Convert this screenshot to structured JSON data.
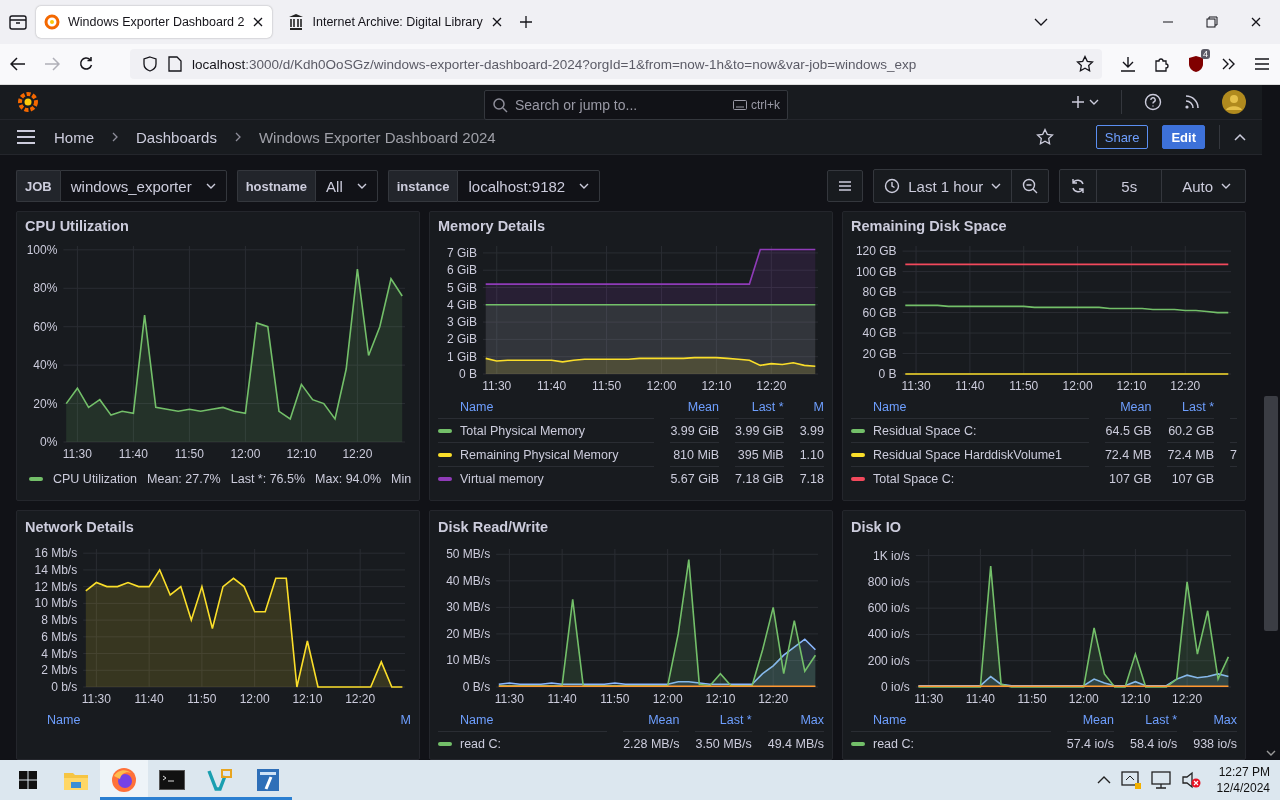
{
  "browser": {
    "tabs": [
      {
        "title": "Windows Exporter Dashboard 2",
        "selected": true
      },
      {
        "title": "Internet Archive: Digital Library",
        "selected": false
      }
    ],
    "url_host": "localhost",
    "url_rest": ":3000/d/Kdh0OoSGz/windows-exporter-dashboard-2024?orgId=1&from=now-1h&to=now&var-job=windows_exp",
    "extension_badge": "4"
  },
  "topbar": {
    "search_placeholder": "Search or jump to...",
    "shortcut": "ctrl+k"
  },
  "breadcrumbs": [
    "Home",
    "Dashboards",
    "Windows Exporter Dashboard 2024"
  ],
  "actions": {
    "share": "Share",
    "edit": "Edit"
  },
  "variables": [
    {
      "label": "JOB",
      "value": "windows_exporter"
    },
    {
      "label": "hostname",
      "value": "All"
    },
    {
      "label": "instance",
      "value": "localhost:9182"
    }
  ],
  "time_range": "Last 1 hour",
  "refresh_interval": "5s",
  "refresh_mode": "Auto",
  "panels": [
    {
      "title": "CPU Utilization",
      "chart_data": {
        "type": "area",
        "grid": true,
        "categories": [
          null,
          "11:30",
          null,
          null,
          null,
          null,
          "11:40",
          null,
          null,
          null,
          null,
          "11:50",
          null,
          null,
          null,
          null,
          "12:00",
          null,
          null,
          null,
          null,
          "12:10",
          null,
          null,
          null,
          null,
          "12:20",
          null,
          null,
          null,
          null
        ],
        "ylim": [
          0,
          102
        ],
        "yticks": [
          {
            "value": 0,
            "label": "0%"
          },
          {
            "value": 20,
            "label": "20%"
          },
          {
            "value": 40,
            "label": "40%"
          },
          {
            "value": 60,
            "label": "60%"
          },
          {
            "value": 80,
            "label": "80%"
          },
          {
            "value": 100,
            "label": "100%"
          }
        ],
        "series": [
          {
            "color": "#73bf69",
            "values": [
              20,
              28,
              18,
              22,
              14,
              16,
              15,
              66,
              18,
              17,
              16,
              17,
              16,
              17,
              18,
              16,
              15,
              62,
              60,
              16,
              12,
              30,
              22,
              20,
              12,
              38,
              90,
              45,
              60,
              85,
              76
            ]
          }
        ]
      },
      "legend": {
        "kind": "inline",
        "items": [
          {
            "name": "CPU Utilization",
            "color": "#73bf69",
            "stats": [
              "Mean: 27.7%",
              "Last *: 76.5%",
              "Max: 94.0%",
              "Min"
            ]
          }
        ]
      }
    },
    {
      "title": "Memory Details",
      "chart_data": {
        "type": "area",
        "grid": true,
        "categories": [
          null,
          "11:30",
          null,
          null,
          null,
          null,
          "11:40",
          null,
          null,
          null,
          null,
          "11:50",
          null,
          null,
          null,
          null,
          "12:00",
          null,
          null,
          null,
          null,
          "12:10",
          null,
          null,
          null,
          null,
          "12:20",
          null,
          null,
          null,
          null
        ],
        "ylim": [
          0,
          7.4
        ],
        "yticks": [
          {
            "value": 0,
            "label": "0 B"
          },
          {
            "value": 1,
            "label": "1 GiB"
          },
          {
            "value": 2,
            "label": "2 GiB"
          },
          {
            "value": 3,
            "label": "3 GiB"
          },
          {
            "value": 4,
            "label": "4 GiB"
          },
          {
            "value": 5,
            "label": "5 GiB"
          },
          {
            "value": 6,
            "label": "6 GiB"
          },
          {
            "value": 7,
            "label": "7 GiB"
          }
        ],
        "series": [
          {
            "color": "#8f3bb8",
            "values": [
              5.2,
              5.2,
              5.2,
              5.2,
              5.2,
              5.2,
              5.2,
              5.2,
              5.2,
              5.2,
              5.2,
              5.2,
              5.2,
              5.2,
              5.2,
              5.2,
              5.2,
              5.2,
              5.2,
              5.2,
              5.2,
              5.2,
              5.2,
              5.2,
              5.2,
              7.2,
              7.2,
              7.2,
              7.2,
              7.2,
              7.2
            ]
          },
          {
            "color": "#73bf69",
            "values": [
              4,
              4,
              4,
              4,
              4,
              4,
              4,
              4,
              4,
              4,
              4,
              4,
              4,
              4,
              4,
              4,
              4,
              4,
              4,
              4,
              4,
              4,
              4,
              4,
              4,
              4,
              4,
              4,
              4,
              4,
              4
            ]
          },
          {
            "color": "#fade2a",
            "values": [
              0.9,
              0.75,
              0.8,
              0.8,
              0.8,
              0.8,
              0.8,
              0.7,
              0.8,
              0.85,
              0.85,
              0.85,
              0.85,
              0.85,
              0.9,
              0.9,
              0.9,
              0.9,
              0.9,
              0.95,
              0.95,
              0.95,
              0.9,
              0.85,
              0.8,
              0.5,
              0.6,
              0.55,
              0.65,
              0.5,
              0.45
            ]
          }
        ]
      },
      "legend": {
        "kind": "table",
        "columns": [
          "Name",
          "Mean",
          "Last *",
          "M"
        ],
        "rows": [
          {
            "name": "Total Physical Memory",
            "color": "#73bf69",
            "values": [
              "3.99 GiB",
              "3.99 GiB",
              "3.99"
            ]
          },
          {
            "name": "Remaining Physical Memory",
            "color": "#fade2a",
            "values": [
              "810 MiB",
              "395 MiB",
              "1.10"
            ]
          },
          {
            "name": "Virtual memory",
            "color": "#8f3bb8",
            "values": [
              "5.67 GiB",
              "7.18 GiB",
              "7.18"
            ]
          }
        ]
      }
    },
    {
      "title": "Remaining Disk Space",
      "chart_data": {
        "type": "line",
        "grid": true,
        "categories": [
          null,
          "11:30",
          null,
          null,
          null,
          null,
          "11:40",
          null,
          null,
          null,
          null,
          "11:50",
          null,
          null,
          null,
          null,
          "12:00",
          null,
          null,
          null,
          null,
          "12:10",
          null,
          null,
          null,
          null,
          "12:20",
          null,
          null,
          null,
          null
        ],
        "ylim": [
          0,
          125
        ],
        "yticks": [
          {
            "value": 0,
            "label": "0 B"
          },
          {
            "value": 20,
            "label": "20 GB"
          },
          {
            "value": 40,
            "label": "40 GB"
          },
          {
            "value": 60,
            "label": "60 GB"
          },
          {
            "value": 80,
            "label": "80 GB"
          },
          {
            "value": 100,
            "label": "100 GB"
          },
          {
            "value": 120,
            "label": "120 GB"
          }
        ],
        "series": [
          {
            "color": "#73bf69",
            "values": [
              67,
              67,
              67,
              67,
              66,
              66,
              66,
              66,
              66,
              66,
              66,
              66,
              65,
              65,
              65,
              65,
              65,
              65,
              65,
              64,
              64,
              64,
              64,
              63,
              63,
              63,
              62,
              62,
              61,
              60,
              60
            ]
          },
          {
            "color": "#fade2a",
            "values": [
              0,
              0,
              0,
              0,
              0,
              0,
              0,
              0,
              0,
              0,
              0,
              0,
              0,
              0,
              0,
              0,
              0,
              0,
              0,
              0,
              0,
              0,
              0,
              0,
              0,
              0,
              0,
              0,
              0,
              0,
              0
            ]
          },
          {
            "color": "#f2495c",
            "values": [
              107,
              107,
              107,
              107,
              107,
              107,
              107,
              107,
              107,
              107,
              107,
              107,
              107,
              107,
              107,
              107,
              107,
              107,
              107,
              107,
              107,
              107,
              107,
              107,
              107,
              107,
              107,
              107,
              107,
              107,
              107
            ]
          }
        ]
      },
      "legend": {
        "kind": "table",
        "columns": [
          "Name",
          "Mean",
          "Last *"
        ],
        "rows": [
          {
            "name": "Residual Space C:",
            "color": "#73bf69",
            "values": [
              "64.5 GB",
              "60.2 GB"
            ]
          },
          {
            "name": "Residual Space HarddiskVolume1",
            "color": "#fade2a",
            "values": [
              "72.4 MB",
              "72.4 MB",
              "7"
            ]
          },
          {
            "name": "Total Space C:",
            "color": "#f2495c",
            "values": [
              "107 GB",
              "107 GB"
            ]
          }
        ]
      }
    },
    {
      "title": "Network Details",
      "chart_data": {
        "type": "area",
        "grid": true,
        "categories": [
          null,
          "11:30",
          null,
          null,
          null,
          null,
          "11:40",
          null,
          null,
          null,
          null,
          "11:50",
          null,
          null,
          null,
          null,
          "12:00",
          null,
          null,
          null,
          null,
          "12:10",
          null,
          null,
          null,
          null,
          "12:20",
          null,
          null,
          null,
          null
        ],
        "ylim": [
          0,
          16.5
        ],
        "yticks": [
          {
            "value": 0,
            "label": "0 b/s"
          },
          {
            "value": 2,
            "label": "2 Mb/s"
          },
          {
            "value": 4,
            "label": "4 Mb/s"
          },
          {
            "value": 6,
            "label": "6 Mb/s"
          },
          {
            "value": 8,
            "label": "8 Mb/s"
          },
          {
            "value": 10,
            "label": "10 Mb/s"
          },
          {
            "value": 12,
            "label": "12 Mb/s"
          },
          {
            "value": 14,
            "label": "14 Mb/s"
          },
          {
            "value": 16,
            "label": "16 Mb/s"
          }
        ],
        "series": [
          {
            "color": "#fade2a",
            "values": [
              11.5,
              12.5,
              12,
              12,
              12.5,
              12,
              12,
              14,
              11,
              12,
              8,
              12,
              7,
              12,
              13,
              12,
              9,
              9,
              13,
              13,
              0,
              5.5,
              0,
              0,
              0,
              0,
              0,
              0,
              3,
              0,
              0
            ]
          }
        ]
      },
      "legend": {
        "kind": "table",
        "columns": [
          "Name",
          "M"
        ]
      }
    },
    {
      "title": "Disk Read/Write",
      "chart_data": {
        "type": "area",
        "grid": true,
        "categories": [
          null,
          "11:30",
          null,
          null,
          null,
          null,
          "11:40",
          null,
          null,
          null,
          null,
          "11:50",
          null,
          null,
          null,
          null,
          "12:00",
          null,
          null,
          null,
          null,
          "12:10",
          null,
          null,
          null,
          null,
          "12:20",
          null,
          null,
          null,
          null
        ],
        "ylim": [
          0,
          52
        ],
        "yticks": [
          {
            "value": 0,
            "label": "0 B/s"
          },
          {
            "value": 10,
            "label": "10 MB/s"
          },
          {
            "value": 20,
            "label": "20 MB/s"
          },
          {
            "value": 30,
            "label": "30 MB/s"
          },
          {
            "value": 40,
            "label": "40 MB/s"
          },
          {
            "value": 50,
            "label": "50 MB/s"
          }
        ],
        "series": [
          {
            "color": "#8ab8ff",
            "values": [
              1,
              1.5,
              1,
              1,
              1,
              1.5,
              1,
              1,
              1,
              1,
              1,
              1.5,
              1,
              1,
              1,
              1,
              1,
              2,
              2,
              1.5,
              1,
              1,
              1,
              1,
              1,
              5,
              8,
              12,
              15,
              18,
              14
            ]
          },
          {
            "color": "#73bf69",
            "values": [
              0.5,
              0.5,
              0.5,
              0.5,
              0.5,
              0.5,
              0.5,
              33,
              0.5,
              0.5,
              0.5,
              0.5,
              0.5,
              0.5,
              0.5,
              0.5,
              0.5,
              20,
              48,
              1,
              0.5,
              5,
              0.5,
              0.5,
              0.5,
              14,
              30,
              5,
              25,
              6,
              12
            ]
          },
          {
            "color": "#ff9830",
            "values": [
              0.3,
              0.3,
              0.3,
              0.3,
              0.3,
              0.3,
              0.3,
              0.3,
              0.3,
              0.3,
              0.3,
              0.3,
              0.3,
              0.3,
              0.3,
              0.3,
              0.3,
              0.3,
              0.3,
              0.3,
              0.3,
              0.3,
              0.3,
              0.3,
              0.3,
              0.3,
              0.3,
              0.3,
              0.3,
              0.3,
              0.3
            ]
          }
        ]
      },
      "legend": {
        "kind": "table",
        "columns": [
          "Name",
          "Mean",
          "Last *",
          "Max"
        ],
        "rows": [
          {
            "name": "read C:",
            "color": "#73bf69",
            "values": [
              "2.28 MB/s",
              "3.50 MB/s",
              "49.4 MB/s"
            ]
          }
        ]
      }
    },
    {
      "title": "Disk IO",
      "chart_data": {
        "type": "area",
        "grid": true,
        "categories": [
          null,
          "11:30",
          null,
          null,
          null,
          null,
          "11:40",
          null,
          null,
          null,
          null,
          "11:50",
          null,
          null,
          null,
          null,
          "12:00",
          null,
          null,
          null,
          null,
          "12:10",
          null,
          null,
          null,
          null,
          "12:20",
          null,
          null,
          null,
          null
        ],
        "ylim": [
          0,
          1050
        ],
        "yticks": [
          {
            "value": 0,
            "label": "0 io/s"
          },
          {
            "value": 200,
            "label": "200 io/s"
          },
          {
            "value": 400,
            "label": "400 io/s"
          },
          {
            "value": 600,
            "label": "600 io/s"
          },
          {
            "value": 800,
            "label": "800 io/s"
          },
          {
            "value": 1000,
            "label": "1K io/s"
          }
        ],
        "series": [
          {
            "color": "#8ab8ff",
            "values": [
              10,
              10,
              10,
              10,
              10,
              10,
              10,
              80,
              20,
              10,
              10,
              10,
              10,
              10,
              10,
              10,
              10,
              60,
              30,
              10,
              10,
              40,
              10,
              10,
              10,
              60,
              90,
              70,
              80,
              100,
              80
            ]
          },
          {
            "color": "#73bf69",
            "values": [
              0,
              0,
              0,
              0,
              0,
              0,
              0,
              920,
              20,
              0,
              0,
              0,
              0,
              0,
              0,
              0,
              0,
              450,
              100,
              0,
              0,
              250,
              0,
              0,
              0,
              60,
              800,
              250,
              580,
              60,
              230
            ]
          },
          {
            "color": "#ff9830",
            "values": [
              5,
              5,
              5,
              5,
              5,
              5,
              5,
              5,
              5,
              5,
              5,
              5,
              5,
              5,
              5,
              5,
              5,
              5,
              5,
              5,
              5,
              5,
              5,
              5,
              5,
              5,
              5,
              5,
              5,
              5,
              5
            ]
          }
        ]
      },
      "legend": {
        "kind": "table",
        "columns": [
          "Name",
          "Mean",
          "Last *",
          "Max"
        ],
        "rows": [
          {
            "name": "read C:",
            "color": "#73bf69",
            "values": [
              "57.4 io/s",
              "58.4 io/s",
              "938 io/s"
            ]
          }
        ]
      }
    }
  ],
  "taskbar": {
    "apps": [
      {
        "kind": "folder",
        "running": false,
        "selected": false
      },
      {
        "kind": "browser",
        "running": true,
        "selected": true
      },
      {
        "kind": "terminal",
        "running": true,
        "selected": false
      },
      {
        "kind": "editor",
        "running": true,
        "selected": false
      },
      {
        "kind": "archive",
        "running": true,
        "selected": false
      }
    ],
    "time": "12:27 PM",
    "date": "12/4/2024"
  }
}
